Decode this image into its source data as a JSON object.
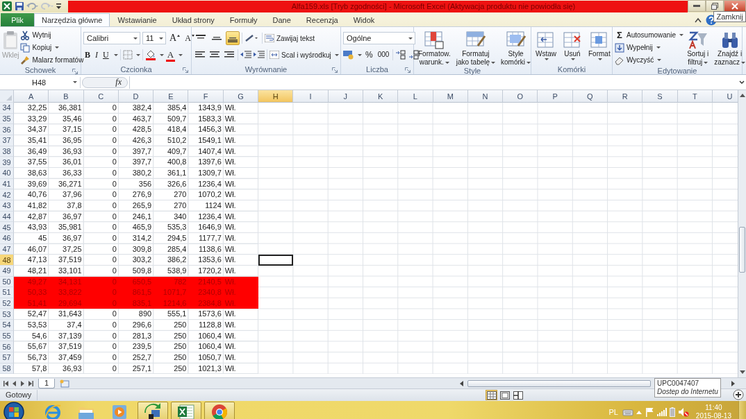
{
  "window": {
    "title": "Alfa159.xls [Tryb zgodności] - Microsoft Excel (Aktywacja produktu nie powiodła się)",
    "tooltip": "Zamknij"
  },
  "tabs": [
    {
      "label": "Plik",
      "kind": "file",
      "selected": false
    },
    {
      "label": "Narzędzia główne",
      "kind": "tab",
      "selected": true
    },
    {
      "label": "Wstawianie",
      "kind": "tab",
      "selected": false
    },
    {
      "label": "Układ strony",
      "kind": "tab",
      "selected": false
    },
    {
      "label": "Formuły",
      "kind": "tab",
      "selected": false
    },
    {
      "label": "Dane",
      "kind": "tab",
      "selected": false
    },
    {
      "label": "Recenzja",
      "kind": "tab",
      "selected": false
    },
    {
      "label": "Widok",
      "kind": "tab",
      "selected": false
    }
  ],
  "ribbon": {
    "clipboard": {
      "label": "Schowek",
      "paste": {
        "label": "Wklej",
        "disabled": true
      },
      "items": [
        {
          "label": "Wytnij",
          "kind": "cut",
          "dropdown": false
        },
        {
          "label": "Kopiuj",
          "kind": "copy",
          "dropdown": true
        },
        {
          "label": "Malarz formatów",
          "kind": "painter",
          "dropdown": false
        }
      ]
    },
    "font": {
      "label": "Czcionka",
      "family": "Calibri",
      "size": "11",
      "grow": "A",
      "shrink": "A",
      "bold": "B",
      "italic": "I",
      "underline": "U",
      "color_letter": "A"
    },
    "alignment": {
      "label": "Wyrównanie",
      "vertical": [
        {
          "kind": "top",
          "selected": false
        },
        {
          "kind": "middle",
          "selected": false
        },
        {
          "kind": "bottom",
          "selected": true
        }
      ],
      "wrap": "Zawijaj tekst",
      "merge": "Scal i wyśrodkuj"
    },
    "number": {
      "label": "Liczba",
      "format": "Ogólne",
      "percent": "%",
      "thousands": "000"
    },
    "styles": {
      "label": "Style",
      "items": [
        {
          "kind": "conditional",
          "lines": [
            "Formatow.",
            "warunk."
          ]
        },
        {
          "kind": "table",
          "lines": [
            "Formatuj",
            "jako tabelę"
          ]
        },
        {
          "kind": "cellstyle",
          "lines": [
            "Style",
            "komórki"
          ]
        }
      ]
    },
    "cells": {
      "label": "Komórki",
      "items": [
        {
          "kind": "insert",
          "lines": [
            "Wstaw"
          ]
        },
        {
          "kind": "delete",
          "lines": [
            "Usuń"
          ]
        },
        {
          "kind": "format",
          "lines": [
            "Format"
          ]
        }
      ]
    },
    "editing": {
      "label": "Edytowanie",
      "items": [
        {
          "kind": "sum",
          "label": "Autosumowanie",
          "glyph": "Σ"
        },
        {
          "kind": "fill",
          "label": "Wypełnij"
        },
        {
          "kind": "clear",
          "label": "Wyczyść"
        }
      ],
      "big": [
        {
          "kind": "sort",
          "lines": [
            "Sortuj i",
            "filtruj"
          ]
        },
        {
          "kind": "find",
          "lines": [
            "Znajdź i",
            "zaznacz"
          ]
        }
      ]
    }
  },
  "formula_bar": {
    "name_box": "H48",
    "fx": "fx"
  },
  "sheet": {
    "columns": [
      {
        "label": "A",
        "selected": false
      },
      {
        "label": "B",
        "selected": false
      },
      {
        "label": "C",
        "selected": false
      },
      {
        "label": "D",
        "selected": false
      },
      {
        "label": "E",
        "selected": false
      },
      {
        "label": "F",
        "selected": false
      },
      {
        "label": "G",
        "selected": false
      },
      {
        "label": "H",
        "selected": true
      },
      {
        "label": "I",
        "selected": false
      },
      {
        "label": "J",
        "selected": false
      },
      {
        "label": "K",
        "selected": false
      },
      {
        "label": "L",
        "selected": false
      },
      {
        "label": "M",
        "selected": false
      },
      {
        "label": "N",
        "selected": false
      },
      {
        "label": "O",
        "selected": false
      },
      {
        "label": "P",
        "selected": false
      },
      {
        "label": "Q",
        "selected": false
      },
      {
        "label": "R",
        "selected": false
      },
      {
        "label": "S",
        "selected": false
      },
      {
        "label": "T",
        "selected": false
      },
      {
        "label": "U",
        "selected": false
      }
    ],
    "rows": [
      {
        "number": "34",
        "cells": [
          "32,25",
          "36,381",
          "0",
          "382,4",
          "385,4",
          "1343,9",
          "Wł."
        ],
        "highlighted": false,
        "selected": false
      },
      {
        "number": "35",
        "cells": [
          "33,29",
          "35,46",
          "0",
          "463,7",
          "509,7",
          "1583,3",
          "Wł."
        ],
        "highlighted": false,
        "selected": false
      },
      {
        "number": "36",
        "cells": [
          "34,37",
          "37,15",
          "0",
          "428,5",
          "418,4",
          "1456,3",
          "Wł."
        ],
        "highlighted": false,
        "selected": false
      },
      {
        "number": "37",
        "cells": [
          "35,41",
          "36,95",
          "0",
          "426,3",
          "510,2",
          "1549,1",
          "Wł."
        ],
        "highlighted": false,
        "selected": false
      },
      {
        "number": "38",
        "cells": [
          "36,49",
          "36,93",
          "0",
          "397,7",
          "409,7",
          "1407,4",
          "Wł."
        ],
        "highlighted": false,
        "selected": false
      },
      {
        "number": "39",
        "cells": [
          "37,55",
          "36,01",
          "0",
          "397,7",
          "400,8",
          "1397,6",
          "Wł."
        ],
        "highlighted": false,
        "selected": false
      },
      {
        "number": "40",
        "cells": [
          "38,63",
          "36,33",
          "0",
          "380,2",
          "361,1",
          "1309,7",
          "Wł."
        ],
        "highlighted": false,
        "selected": false
      },
      {
        "number": "41",
        "cells": [
          "39,69",
          "36,271",
          "0",
          "356",
          "326,6",
          "1236,4",
          "Wł."
        ],
        "highlighted": false,
        "selected": false
      },
      {
        "number": "42",
        "cells": [
          "40,76",
          "37,96",
          "0",
          "276,9",
          "270",
          "1070,2",
          "Wł."
        ],
        "highlighted": false,
        "selected": false
      },
      {
        "number": "43",
        "cells": [
          "41,82",
          "37,8",
          "0",
          "265,9",
          "270",
          "1124",
          "Wł."
        ],
        "highlighted": false,
        "selected": false
      },
      {
        "number": "44",
        "cells": [
          "42,87",
          "36,97",
          "0",
          "246,1",
          "340",
          "1236,4",
          "Wł."
        ],
        "highlighted": false,
        "selected": false
      },
      {
        "number": "45",
        "cells": [
          "43,93",
          "35,981",
          "0",
          "465,9",
          "535,3",
          "1646,9",
          "Wł."
        ],
        "highlighted": false,
        "selected": false
      },
      {
        "number": "46",
        "cells": [
          "45",
          "36,97",
          "0",
          "314,2",
          "294,5",
          "1177,7",
          "Wł."
        ],
        "highlighted": false,
        "selected": false
      },
      {
        "number": "47",
        "cells": [
          "46,07",
          "37,25",
          "0",
          "309,8",
          "285,4",
          "1138,6",
          "Wł."
        ],
        "highlighted": false,
        "selected": false
      },
      {
        "number": "48",
        "cells": [
          "47,13",
          "37,519",
          "0",
          "303,2",
          "386,2",
          "1353,6",
          "Wł."
        ],
        "highlighted": false,
        "selected": true
      },
      {
        "number": "49",
        "cells": [
          "48,21",
          "33,101",
          "0",
          "509,8",
          "538,9",
          "1720,2",
          "Wł."
        ],
        "highlighted": false,
        "selected": false
      },
      {
        "number": "50",
        "cells": [
          "49,27",
          "34,131",
          "0",
          "650,5",
          "782",
          "2140,5",
          "Wł."
        ],
        "highlighted": true,
        "selected": false
      },
      {
        "number": "51",
        "cells": [
          "50,33",
          "33,822",
          "0",
          "861,5",
          "1071,7",
          "2340,8",
          "Wł."
        ],
        "highlighted": true,
        "selected": false
      },
      {
        "number": "52",
        "cells": [
          "51,41",
          "29,694",
          "0",
          "835,1",
          "1214,6",
          "2384,8",
          "Wł."
        ],
        "highlighted": true,
        "selected": false
      },
      {
        "number": "53",
        "cells": [
          "52,47",
          "31,643",
          "0",
          "890",
          "555,1",
          "1573,6",
          "Wł."
        ],
        "highlighted": false,
        "selected": false
      },
      {
        "number": "54",
        "cells": [
          "53,53",
          "37,4",
          "0",
          "296,6",
          "250",
          "1128,8",
          "Wł."
        ],
        "highlighted": false,
        "selected": false
      },
      {
        "number": "55",
        "cells": [
          "54,6",
          "37,139",
          "0",
          "281,3",
          "250",
          "1060,4",
          "Wł."
        ],
        "highlighted": false,
        "selected": false
      },
      {
        "number": "56",
        "cells": [
          "55,67",
          "37,519",
          "0",
          "239,5",
          "250",
          "1060,4",
          "Wł."
        ],
        "highlighted": false,
        "selected": false
      },
      {
        "number": "57",
        "cells": [
          "56,73",
          "37,459",
          "0",
          "252,7",
          "250",
          "1050,7",
          "Wł."
        ],
        "highlighted": false,
        "selected": false
      },
      {
        "number": "58",
        "cells": [
          "57,8",
          "36,93",
          "0",
          "257,1",
          "250",
          "1021,3",
          "Wł."
        ],
        "highlighted": false,
        "selected": false
      }
    ]
  },
  "sheet_tabs": [
    {
      "label": "1",
      "selected": true
    }
  ],
  "status_bar": {
    "text": "Gotowy",
    "views": [
      {
        "kind": "normal",
        "selected": true
      },
      {
        "kind": "layout",
        "selected": false
      },
      {
        "kind": "pagebreak",
        "selected": false
      }
    ]
  },
  "network_tooltip": {
    "title": "UPC0047407",
    "subtitle": "Dostep do Internetu"
  },
  "taskbar": {
    "apps": [
      {
        "kind": "ie",
        "open": false
      },
      {
        "kind": "explorer",
        "open": false
      },
      {
        "kind": "media",
        "open": false
      },
      {
        "kind": "sync",
        "open": true
      },
      {
        "kind": "excel",
        "open": true
      },
      {
        "kind": "chrome",
        "open": true
      }
    ],
    "language": "PL",
    "time": "11:40",
    "date": "2015-08-13"
  }
}
